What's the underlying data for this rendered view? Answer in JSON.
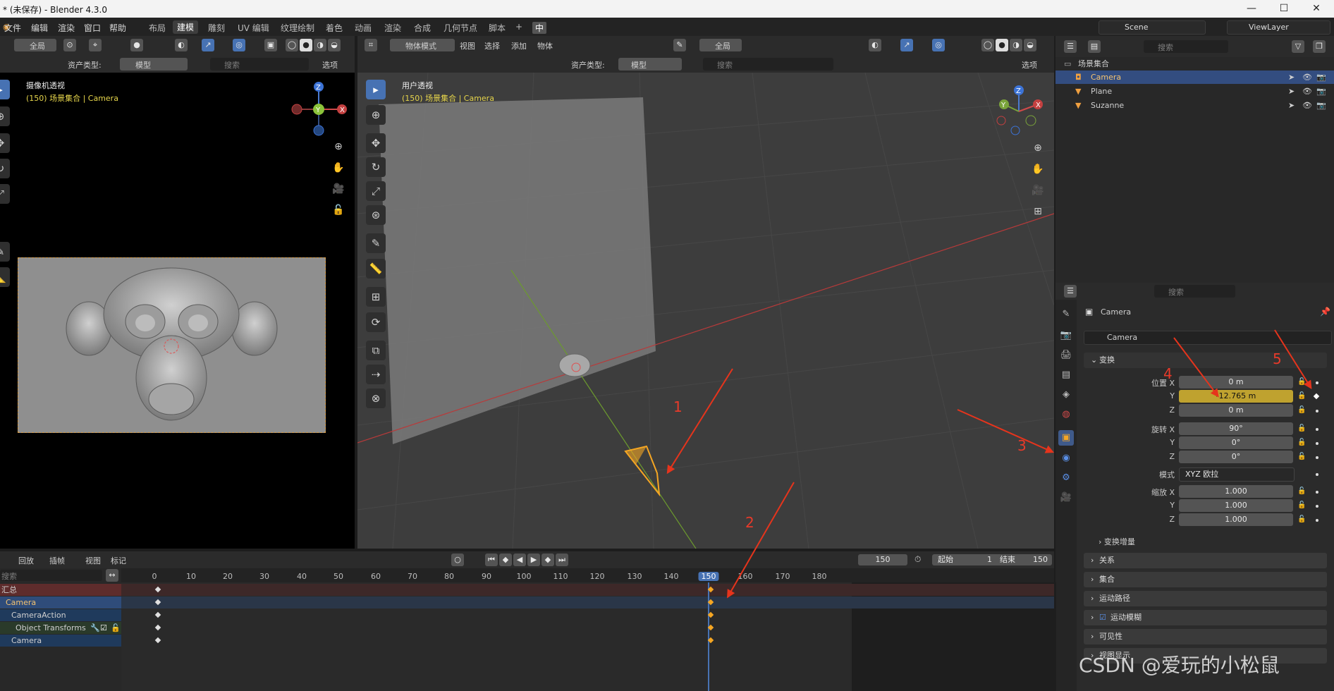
{
  "window": {
    "title": "* (未保存) - Blender 4.3.0",
    "minimize": "—",
    "maximize": "☐",
    "close": "✕"
  },
  "menu": {
    "items": [
      "文件",
      "编辑",
      "渲染",
      "窗口",
      "帮助"
    ],
    "workspaces": [
      "布局",
      "建模",
      "雕刻",
      "UV 编辑",
      "纹理绘制",
      "着色",
      "动画",
      "渲染",
      "合成",
      "几何节点",
      "脚本"
    ],
    "active_workspace": "建模",
    "add_tab": "+",
    "ime": "中",
    "scene": "Scene",
    "view_layer": "ViewLayer"
  },
  "left_view": {
    "global": "全局",
    "asset_type_label": "资产类型:",
    "asset_type": "模型",
    "search_placeholder": "搜索",
    "options": "选项",
    "title": "摄像机透视",
    "subtitle": "(150) 场景集合 | Camera"
  },
  "main_view": {
    "mode": "物体模式",
    "menus": [
      "视图",
      "选择",
      "添加",
      "物体"
    ],
    "global": "全局",
    "asset_type_label": "资产类型:",
    "asset_type": "模型",
    "search_placeholder": "搜索",
    "options": "选项",
    "title": "用户透视",
    "subtitle": "(150) 场景集合 | Camera"
  },
  "outliner": {
    "search_placeholder": "搜索",
    "collection": "场景集合",
    "objects": [
      "Camera",
      "Plane",
      "Suzanne"
    ]
  },
  "properties": {
    "search_placeholder": "搜索",
    "object_name_header": "Camera",
    "object_name_field": "Camera",
    "transform_title": "变换",
    "location_label": "位置 X",
    "location": [
      "0 m",
      "-12.765 m",
      "0 m"
    ],
    "rotation_label": "旋转 X",
    "rotation": [
      "90°",
      "0°",
      "0°"
    ],
    "mode_label": "模式",
    "mode_value": "XYZ 欧拉",
    "scale_label": "缩放 X",
    "scale": [
      "1.000",
      "1.000",
      "1.000"
    ],
    "axis_y": "Y",
    "axis_z": "Z",
    "delta_transform": "变换增量",
    "sections": [
      "关系",
      "集合",
      "运动路径",
      "运动模糊",
      "可见性",
      "视图显示"
    ]
  },
  "timeline": {
    "menus": [
      "回放",
      "插帧",
      "视图",
      "标记"
    ],
    "current_frame": "150",
    "start_label": "起始",
    "start": "1",
    "end_label": "结束",
    "end": "150",
    "search_placeholder": "搜索",
    "ticks": [
      "0",
      "10",
      "20",
      "30",
      "40",
      "50",
      "60",
      "70",
      "80",
      "90",
      "100",
      "110",
      "120",
      "130",
      "140",
      "150",
      "160",
      "170",
      "180"
    ],
    "channels": [
      "汇总",
      "Camera",
      "CameraAction",
      "Object Transforms",
      "Camera"
    ]
  },
  "annotations": [
    "1",
    "2",
    "3",
    "4",
    "5"
  ],
  "watermark": "CSDN @爱玩的小松鼠",
  "colors": {
    "accent_blue": "#4772b3",
    "keyframe_yellow": "#bfa22f",
    "annotation_red": "#e6341c",
    "selection_orange": "#f5a623"
  }
}
